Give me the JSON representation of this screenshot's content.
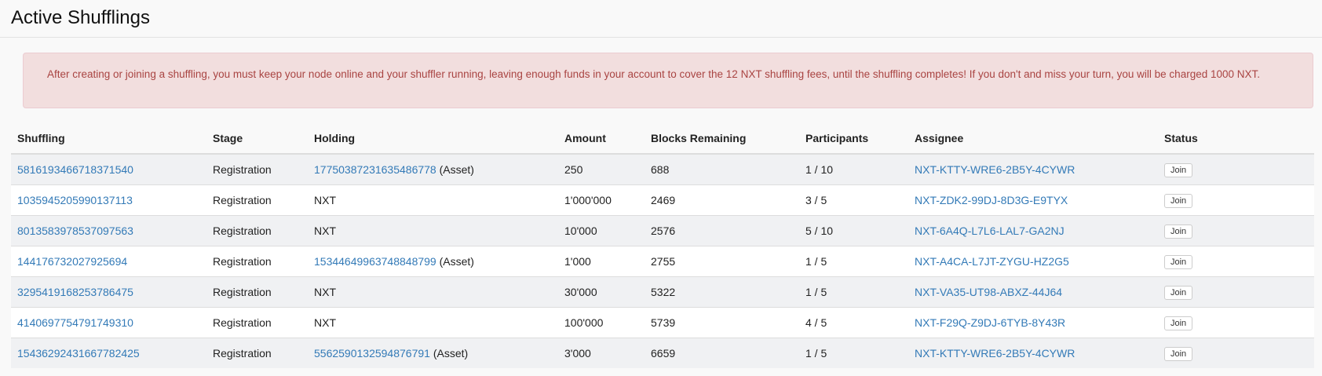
{
  "header": {
    "title": "Active Shufflings"
  },
  "alert": {
    "text": "After creating or joining a shuffling, you must keep your node online and your shuffler running, leaving enough funds in your account to cover the 12 NXT shuffling fees, until the shuffling completes! If you don't and miss your turn, you will be charged 1000 NXT."
  },
  "table": {
    "columns": [
      "Shuffling",
      "Stage",
      "Holding",
      "Amount",
      "Blocks Remaining",
      "Participants",
      "Assignee",
      "Status"
    ],
    "rows": [
      {
        "shuffling": "5816193466718371540",
        "stage": "Registration",
        "holding": "17750387231635486778",
        "holding_suffix": " (Asset)",
        "amount": "250",
        "blocks": "688",
        "participants": "1 / 10",
        "assignee": "NXT-KTTY-WRE6-2B5Y-4CYWR",
        "status": "Join"
      },
      {
        "shuffling": "1035945205990137113",
        "stage": "Registration",
        "holding": "NXT",
        "holding_suffix": "",
        "amount": "1'000'000",
        "blocks": "2469",
        "participants": "3 / 5",
        "assignee": "NXT-ZDK2-99DJ-8D3G-E9TYX",
        "status": "Join"
      },
      {
        "shuffling": "8013583978537097563",
        "stage": "Registration",
        "holding": "NXT",
        "holding_suffix": "",
        "amount": "10'000",
        "blocks": "2576",
        "participants": "5 / 10",
        "assignee": "NXT-6A4Q-L7L6-LAL7-GA2NJ",
        "status": "Join"
      },
      {
        "shuffling": "144176732027925694",
        "stage": "Registration",
        "holding": "15344649963748848799",
        "holding_suffix": " (Asset)",
        "amount": "1'000",
        "blocks": "2755",
        "participants": "1 / 5",
        "assignee": "NXT-A4CA-L7JT-ZYGU-HZ2G5",
        "status": "Join"
      },
      {
        "shuffling": "3295419168253786475",
        "stage": "Registration",
        "holding": "NXT",
        "holding_suffix": "",
        "amount": "30'000",
        "blocks": "5322",
        "participants": "1 / 5",
        "assignee": "NXT-VA35-UT98-ABXZ-44J64",
        "status": "Join"
      },
      {
        "shuffling": "4140697754791749310",
        "stage": "Registration",
        "holding": "NXT",
        "holding_suffix": "",
        "amount": "100'000",
        "blocks": "5739",
        "participants": "4 / 5",
        "assignee": "NXT-F29Q-Z9DJ-6TYB-8Y43R",
        "status": "Join"
      },
      {
        "shuffling": "15436292431667782425",
        "stage": "Registration",
        "holding": "5562590132594876791",
        "holding_suffix": " (Asset)",
        "amount": "3'000",
        "blocks": "6659",
        "participants": "1 / 5",
        "assignee": "NXT-KTTY-WRE6-2B5Y-4CYWR",
        "status": "Join"
      }
    ]
  }
}
